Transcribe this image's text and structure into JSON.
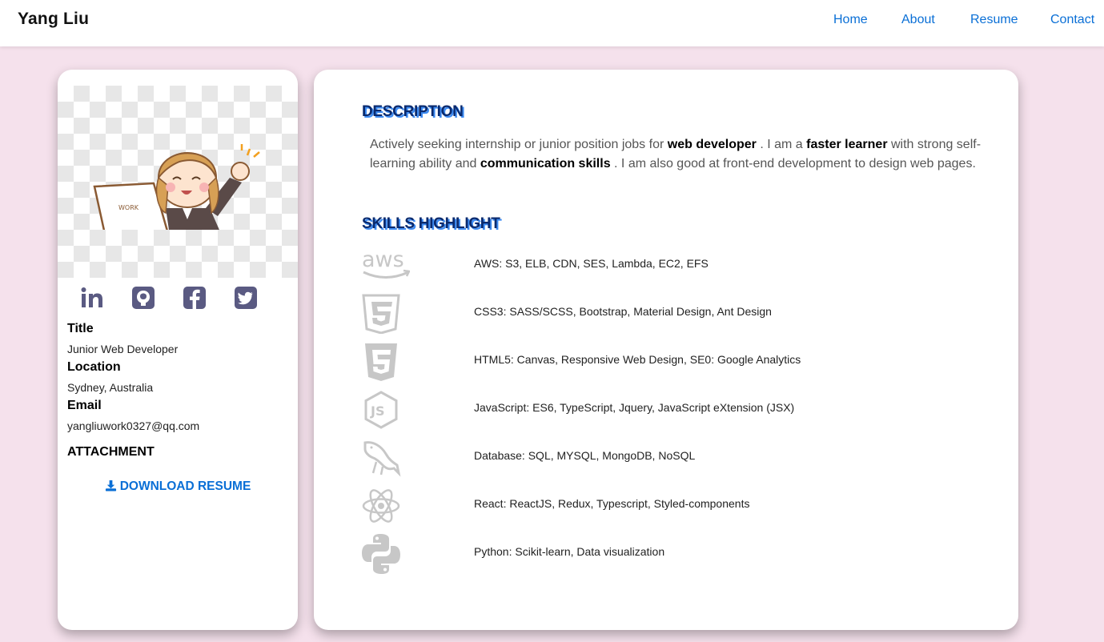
{
  "navbar": {
    "brand": "Yang Liu",
    "links": [
      "Home",
      "About",
      "Resume",
      "Contact"
    ]
  },
  "profile": {
    "image_alt": "WORK",
    "social": [
      "linkedin-icon",
      "github-icon",
      "facebook-icon",
      "twitter-icon"
    ],
    "title_label": "Title",
    "title_value": "Junior Web Developer",
    "location_label": "Location",
    "location_value": "Sydney, Australia",
    "email_label": "Email",
    "email_value": "yangliuwork0327@qq.com",
    "attachment_label": "ATTACHMENT",
    "download_label": "DOWNLOAD RESUME"
  },
  "description": {
    "heading": "DESCRIPTION",
    "p1": "Actively seeking internship or junior position jobs for ",
    "b1": "web developer",
    "p2": " . I am a ",
    "b2": "faster learner",
    "p3": " with strong self-learning ability and ",
    "b3": "communication skills",
    "p4": " . I am also good at front-end development to design web pages."
  },
  "skills": {
    "heading": "SKILLS HIGHLIGHT",
    "items": [
      {
        "icon": "aws-icon",
        "text": "AWS: S3, ELB, CDN, SES, Lambda, EC2, EFS"
      },
      {
        "icon": "css3-icon",
        "text": "CSS3: SASS/SCSS, Bootstrap, Material Design, Ant Design"
      },
      {
        "icon": "html5-icon",
        "text": "HTML5: Canvas, Responsive Web Design, SE0: Google Analytics"
      },
      {
        "icon": "nodejs-icon",
        "text": "JavaScript: ES6, TypeScript, Jquery, JavaScript eXtension (JSX)"
      },
      {
        "icon": "mysql-icon",
        "text": "Database: SQL, MYSQL, MongoDB, NoSQL"
      },
      {
        "icon": "react-icon",
        "text": "React: ReactJS, Redux, Typescript, Styled-components"
      },
      {
        "icon": "python-icon",
        "text": "Python: Scikit-learn, Data visualization"
      }
    ]
  },
  "colors": {
    "accent": "#0a6fd6",
    "background": "#f5e1ec",
    "social_icon": "#5a5a82",
    "skill_icon": "#c7c7c7"
  }
}
